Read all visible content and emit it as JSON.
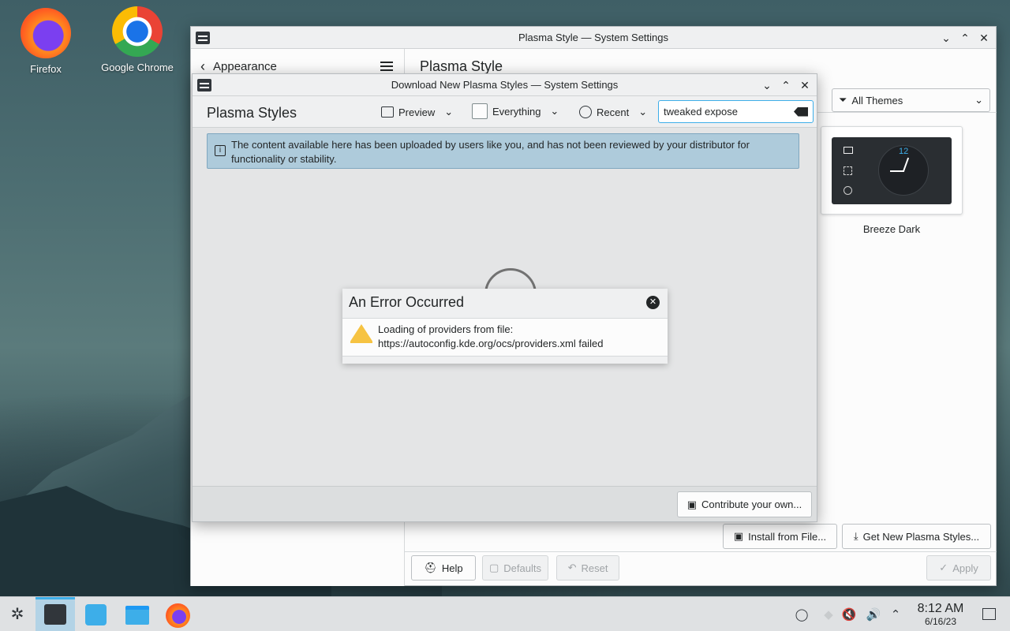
{
  "desktop": {
    "icons": [
      {
        "label": "Firefox"
      },
      {
        "label": "Google Chrome"
      }
    ]
  },
  "main_window": {
    "title": "Plasma Style — System Settings",
    "sidebar_back_label": "Appearance",
    "page_title": "Plasma Style",
    "filter_label": "All Themes",
    "theme_card_label": "Breeze Dark",
    "install_button": "Install from File...",
    "get_new_button": "Get New Plasma Styles...",
    "help_button": "Help",
    "defaults_button": "Defaults",
    "reset_button": "Reset",
    "apply_button": "Apply",
    "clock_number": "12"
  },
  "download_dialog": {
    "title": "Download New Plasma Styles — System Settings",
    "heading": "Plasma Styles",
    "preview_label": "Preview",
    "everything_label": "Everything",
    "recent_label": "Recent",
    "search_value": "tweaked expose",
    "notice": "The content available here has been uploaded by users like you, and has not been reviewed by your distributor for functionality or stability.",
    "contribute_button": "Contribute your own..."
  },
  "error_popup": {
    "title": "An Error Occurred",
    "message": "Loading of providers from file: https://autoconfig.kde.org/ocs/providers.xml failed"
  },
  "taskbar": {
    "time": "8:12 AM",
    "date": "6/16/23"
  },
  "colors": {
    "accent": "#3daee9",
    "notice_bg": "#aecbdb",
    "notice_border": "#7fa7bf",
    "warning": "#f6c342"
  }
}
